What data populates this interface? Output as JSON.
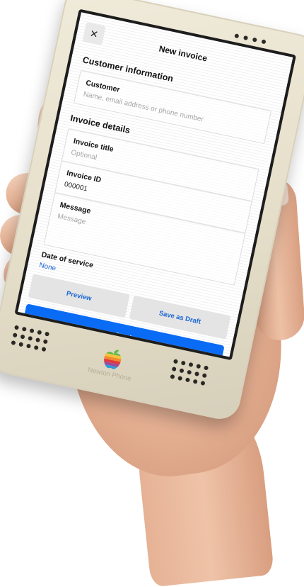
{
  "header": {
    "close_icon": "close-icon",
    "title": "New invoice"
  },
  "customer_section": {
    "heading": "Customer information",
    "customer_field": {
      "label": "Customer",
      "placeholder": "Name, email address or phone number"
    }
  },
  "invoice_section": {
    "heading": "Invoice details",
    "title_field": {
      "label": "Invoice title",
      "placeholder": "Optional"
    },
    "id_field": {
      "label": "Invoice ID",
      "value": "000001"
    },
    "message_field": {
      "label": "Message",
      "placeholder": "Message"
    },
    "date_of_service": {
      "label": "Date of service",
      "value": "None"
    }
  },
  "actions": {
    "preview_label": "Preview",
    "draft_label": "Save as Draft",
    "send_label": "Send"
  },
  "device": {
    "brand": "Newton Phone",
    "logo_icon": "rainbow-apple-icon"
  },
  "colors": {
    "accent": "#0a6cf5",
    "link": "#1a66d6",
    "device_body": "#e4ddc8"
  }
}
